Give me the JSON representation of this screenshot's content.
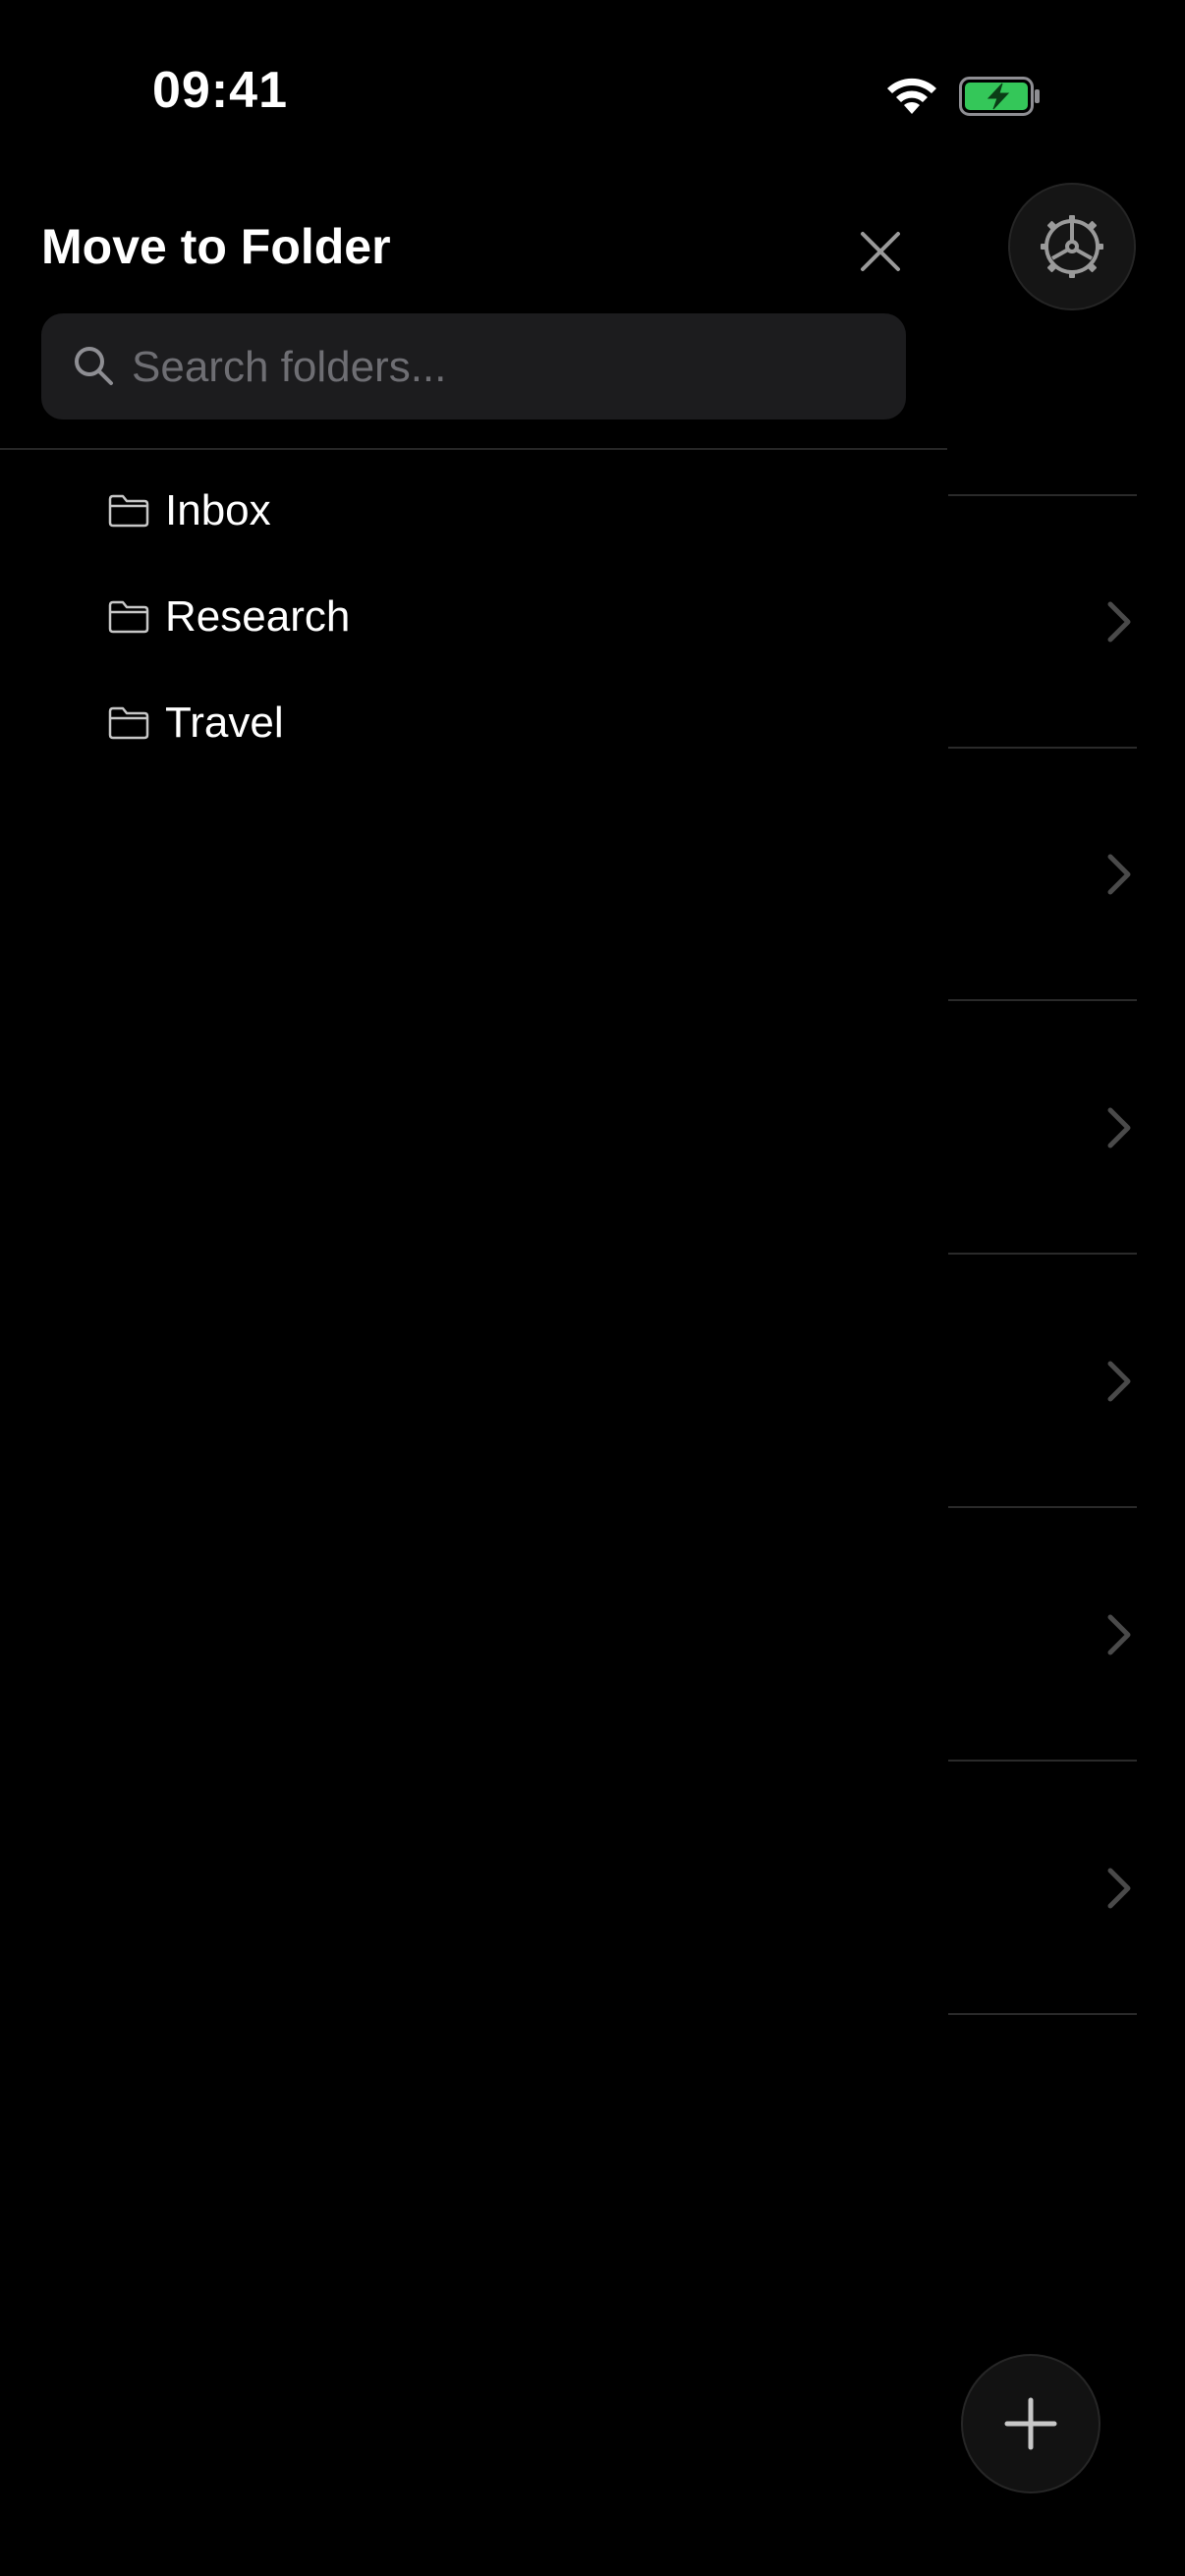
{
  "status_bar": {
    "time": "09:41"
  },
  "drawer": {
    "title": "Move to Folder",
    "search_placeholder": "Search folders...",
    "search_value": "",
    "folders": [
      {
        "label": "Inbox",
        "icon": "folder-icon"
      },
      {
        "label": "Research",
        "icon": "folder-icon"
      },
      {
        "label": "Travel",
        "icon": "folder-icon"
      }
    ]
  },
  "icons": {
    "close": "close-icon",
    "search": "search-icon",
    "settings": "gear-icon",
    "add": "plus-icon",
    "row_chevron": "chevron-right-icon"
  },
  "colors": {
    "background": "#000000",
    "search_field": "#1c1c1e",
    "battery_fill": "#34c759",
    "placeholder": "#6e6e73"
  }
}
